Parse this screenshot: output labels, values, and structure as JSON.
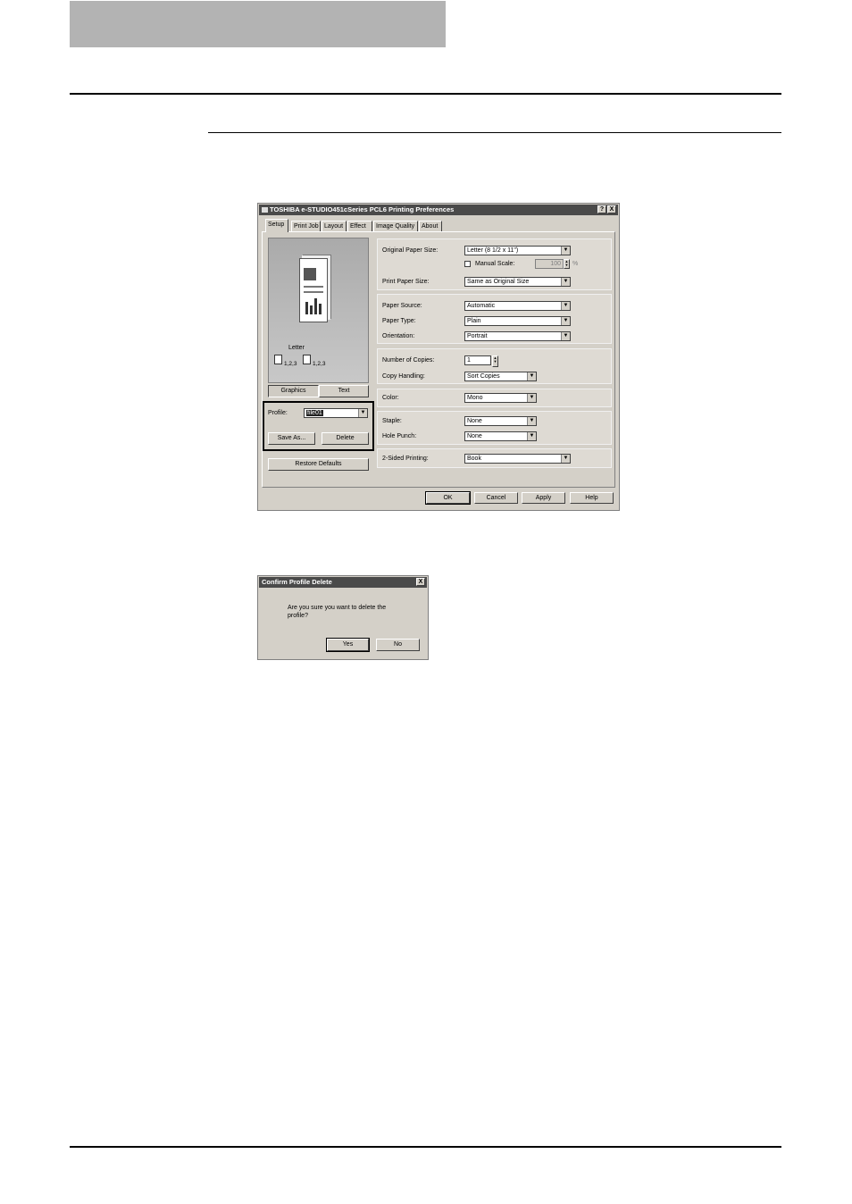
{
  "prefs_dialog": {
    "title": "TOSHIBA e-STUDIO451cSeries PCL6 Printing Preferences",
    "help_button": "?",
    "close_button": "X",
    "tabs": [
      "Setup",
      "Print Job",
      "Layout",
      "Effect",
      "Image Quality",
      "About"
    ],
    "preview": {
      "paper_label": "Letter",
      "copies_icon_1": "1,2,3",
      "copies_icon_2": "1,2,3",
      "view_buttons": [
        "Graphics",
        "Text"
      ]
    },
    "profile": {
      "label": "Profile:",
      "value": "file01",
      "save_as": "Save As...",
      "delete": "Delete"
    },
    "restore_defaults": "Restore Defaults",
    "fields": {
      "original_paper_size": {
        "label": "Original Paper Size:",
        "value": "Letter (8 1/2 x 11\")"
      },
      "manual_scale": {
        "label": "Manual Scale:",
        "value": "100",
        "unit": "%"
      },
      "print_paper_size": {
        "label": "Print Paper Size:",
        "value": "Same as Original Size"
      },
      "paper_source": {
        "label": "Paper Source:",
        "value": "Automatic"
      },
      "paper_type": {
        "label": "Paper Type:",
        "value": "Plain"
      },
      "orientation": {
        "label": "Orientation:",
        "value": "Portrait"
      },
      "number_of_copies": {
        "label": "Number of Copies:",
        "value": "1"
      },
      "copy_handling": {
        "label": "Copy Handling:",
        "value": "Sort Copies"
      },
      "color": {
        "label": "Color:",
        "value": "Mono"
      },
      "staple": {
        "label": "Staple:",
        "value": "None"
      },
      "hole_punch": {
        "label": "Hole Punch:",
        "value": "None"
      },
      "two_sided": {
        "label": "2-Sided Printing:",
        "value": "Book"
      }
    },
    "footer": {
      "ok": "OK",
      "cancel": "Cancel",
      "apply": "Apply",
      "help": "Help"
    }
  },
  "confirm_dialog": {
    "title": "Confirm Profile Delete",
    "close_button": "X",
    "message_line1": "Are you sure you want to delete the",
    "message_line2": "profile?",
    "yes": "Yes",
    "no": "No"
  }
}
